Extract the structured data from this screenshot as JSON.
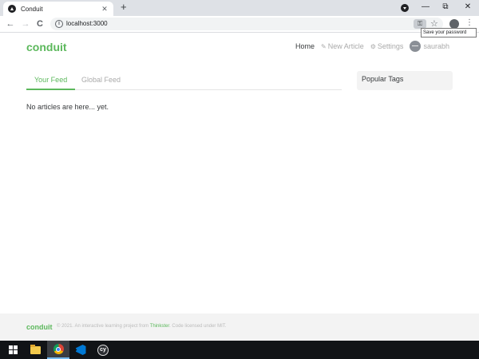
{
  "browser": {
    "tab_title": "Conduit",
    "tab_close": "✕",
    "new_tab": "+",
    "url": "localhost:3000",
    "tooltip": "Save your password",
    "back": "←",
    "forward": "→",
    "reload": "C",
    "minimize": "—",
    "restore": "⧉",
    "close": "✕"
  },
  "nav": {
    "brand": "conduit",
    "home": "Home",
    "new_article": "New Article",
    "settings": "Settings",
    "username": "saurabh"
  },
  "feed": {
    "tabs": [
      "Your Feed",
      "Global Feed"
    ],
    "empty_message": "No articles are here... yet."
  },
  "sidebar": {
    "title": "Popular Tags"
  },
  "footer": {
    "brand": "conduit",
    "text_prefix": "© 2021. An interactive learning project from ",
    "link": "Thinkster",
    "text_suffix": ". Code licensed under MIT."
  },
  "taskbar": {
    "cypress_label": "cy"
  }
}
